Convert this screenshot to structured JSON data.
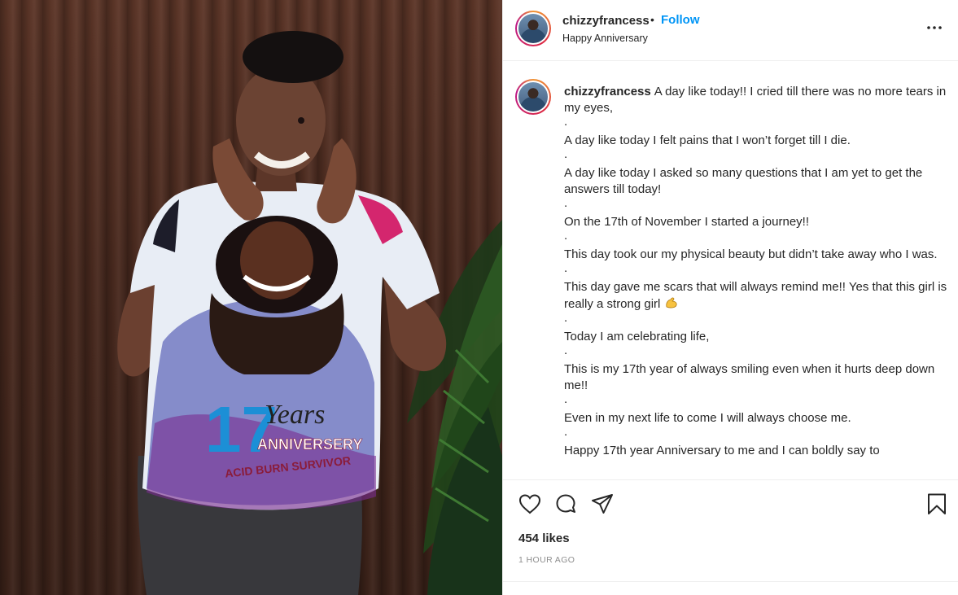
{
  "photo": {
    "shirt_text_number": "17",
    "shirt_text_years": "Years",
    "shirt_text_anniversary": "ANNIVERSERY",
    "shirt_text_survivor": "ACID BURN SURVIVOR"
  },
  "post": {
    "username": "chizzyfrancess",
    "separator": "•",
    "follow_label": "Follow",
    "location": "Happy Anniversary",
    "more_label": "•••",
    "caption_lines": [
      "A day like today!! I cried till there was no more tears in my eyes,",
      ".",
      "A day like today I felt pains that I won’t forget till I die.",
      ".",
      "A day like today I asked so many questions that I am yet to get the answers till today!",
      ".",
      "On the 17th of November I started a journey!!",
      ".",
      "This day took our my physical beauty but didn’t take away who I was.",
      ".",
      "This day gave me scars that will always remind me!! Yes that this girl is really a strong girl",
      ".",
      "Today I am celebrating life,",
      ".",
      "This is my 17th year of always smiling even when it hurts deep down me!!",
      ".",
      "Even in my next life to come I will always choose me.",
      ".",
      "Happy 17th year Anniversary to me and I can boldly say to"
    ],
    "likes": "454 likes",
    "timestamp": "1 HOUR AGO"
  },
  "icons": {
    "like": "heart-icon",
    "comment": "comment-bubble-icon",
    "share": "paper-plane-icon",
    "save": "bookmark-icon",
    "emoji": "flexed-biceps-emoji"
  },
  "colors": {
    "follow_blue": "#0095f6",
    "timestamp_grey": "#8e8e8e",
    "text": "#262626"
  }
}
